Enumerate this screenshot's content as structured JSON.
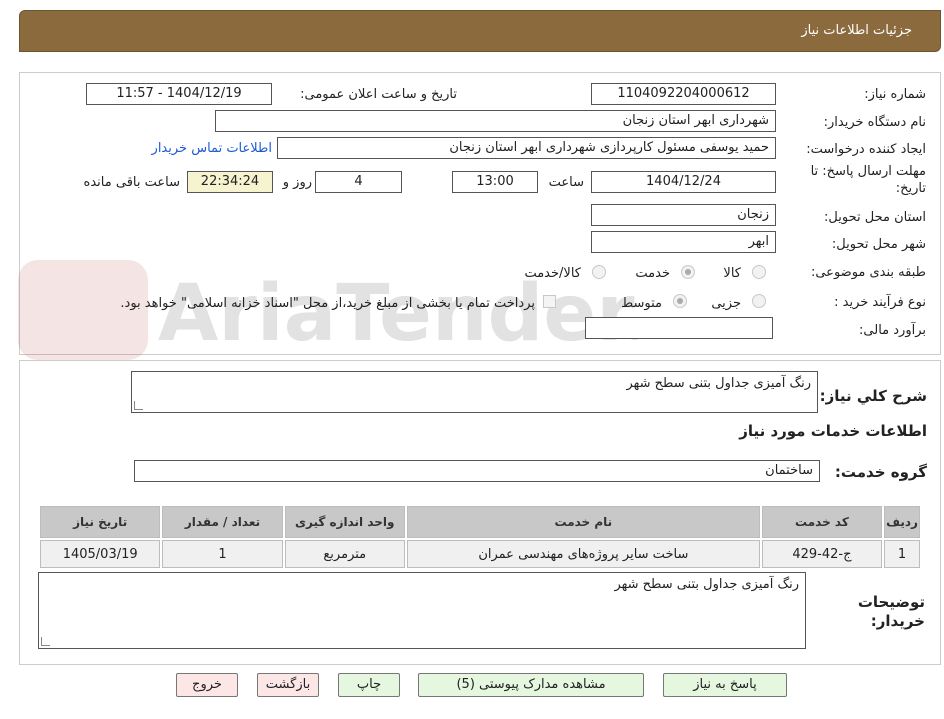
{
  "header": {
    "title": "جزئیات اطلاعات نیاز"
  },
  "form": {
    "need_number_label": "شماره نیاز:",
    "need_number": "1104092204000612",
    "announce_label": "تاریخ و ساعت اعلان عمومی:",
    "announce_value": "1404/12/19 - 11:57",
    "buyer_org_label": "نام دستگاه خریدار:",
    "buyer_org": "شهرداری ابهر استان زنجان",
    "creator_label": "ایجاد کننده درخواست:",
    "creator": "حمید یوسفی مسئول کارپردازی شهرداری ابهر استان زنجان",
    "contact_link": "اطلاعات تماس خریدار",
    "deadline_label_1": "مهلت ارسال پاسخ: تا",
    "deadline_label_2": "تاریخ:",
    "deadline_date": "1404/12/24",
    "time_label": "ساعت",
    "deadline_time": "13:00",
    "days": "4",
    "days_label": "روز و",
    "remaining": "22:34:24",
    "remaining_label": "ساعت باقی مانده",
    "province_label": "استان محل تحویل:",
    "province": "زنجان",
    "city_label": "شهر محل تحویل:",
    "city": "ابهر",
    "category_label": "طبقه بندی موضوعی:",
    "category_options": [
      "کالا",
      "خدمت",
      "کالا/خدمت"
    ],
    "process_label": "نوع فرآیند خرید :",
    "process_options": [
      "جزیی",
      "متوسط"
    ],
    "payment_note": "پرداخت تمام یا بخشی از مبلغ خرید،از محل \"اسناد خزانه اسلامی\" خواهد بود.",
    "estimate_label": "برآورد مالی:",
    "estimate": ""
  },
  "summary": {
    "label": "شرح کلي نیاز:",
    "value": "رنگ آمیزی جداول بتنی سطح شهر"
  },
  "services": {
    "section_title": "اطلاعات خدمات مورد نیاز",
    "group_label": "گروه خدمت:",
    "group": "ساختمان",
    "columns": [
      "ردیف",
      "کد خدمت",
      "نام خدمت",
      "واحد اندازه گیری",
      "تعداد / مقدار",
      "تاریخ نیاز"
    ],
    "rows": [
      [
        "1",
        "ج-42-429",
        "ساخت سایر پروژه‌های مهندسی عمران",
        "مترمربع",
        "1",
        "1405/03/19"
      ]
    ]
  },
  "buyer_notes": {
    "label_1": "توضیحات",
    "label_2": "خریدار:",
    "value": "رنگ آمیزی جداول بتنی سطح شهر"
  },
  "buttons": {
    "reply": "پاسخ به نیاز",
    "attachments": "مشاهده مدارک پیوستی (5)",
    "print": "چاپ",
    "back": "بازگشت",
    "exit": "خروج"
  },
  "watermark": {
    "text": "AriaTender.neT"
  }
}
